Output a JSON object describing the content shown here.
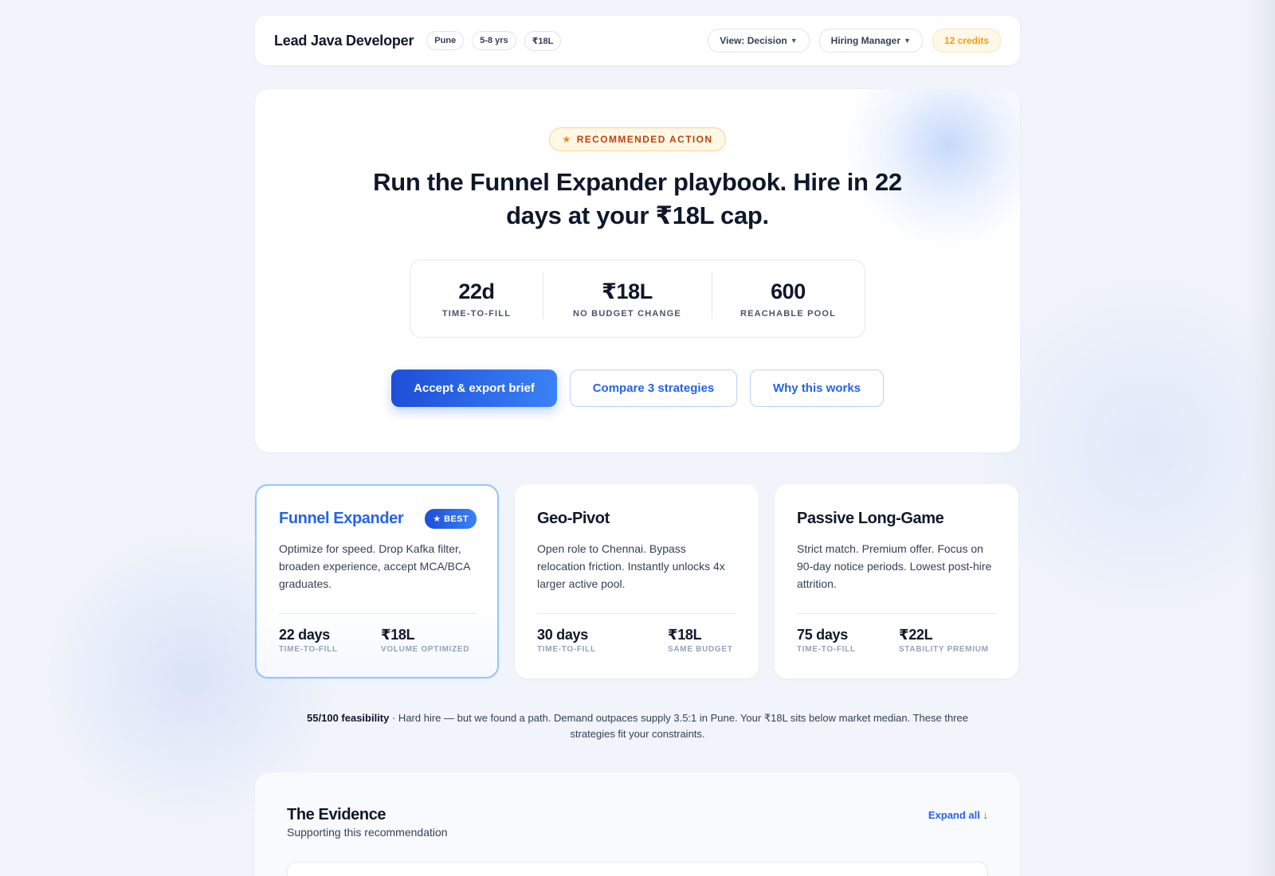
{
  "header": {
    "job_title": "Lead Java Developer",
    "chips": [
      "Pune",
      "5-8 yrs",
      "₹18L"
    ],
    "view_dropdown": "View: Decision",
    "role_dropdown": "Hiring Manager",
    "credits": "12 credits"
  },
  "hero": {
    "badge": "RECOMMENDED ACTION",
    "headline": "Run the Funnel Expander playbook. Hire in 22 days at your ₹18L cap.",
    "stats": [
      {
        "value": "22d",
        "label": "TIME-TO-FILL"
      },
      {
        "value": "₹18L",
        "label": "NO BUDGET CHANGE"
      },
      {
        "value": "600",
        "label": "REACHABLE POOL"
      }
    ],
    "buttons": {
      "accept": "Accept & export brief",
      "compare": "Compare 3 strategies",
      "why": "Why this works"
    }
  },
  "strategies": [
    {
      "title": "Funnel Expander",
      "badge": "BEST",
      "description": "Optimize for speed. Drop Kafka filter, broaden experience, accept MCA/BCA graduates.",
      "metrics": [
        {
          "value": "22 days",
          "label": "TIME-TO-FILL"
        },
        {
          "value": "₹18L",
          "label": "VOLUME OPTIMIZED"
        }
      ]
    },
    {
      "title": "Geo-Pivot",
      "description": "Open role to Chennai. Bypass relocation friction. Instantly unlocks 4x larger active pool.",
      "metrics": [
        {
          "value": "30 days",
          "label": "TIME-TO-FILL"
        },
        {
          "value": "₹18L",
          "label": "SAME BUDGET"
        }
      ]
    },
    {
      "title": "Passive Long-Game",
      "description": "Strict match. Premium offer. Focus on 90-day notice periods. Lowest post-hire attrition.",
      "metrics": [
        {
          "value": "75 days",
          "label": "TIME-TO-FILL"
        },
        {
          "value": "₹22L",
          "label": "STABILITY PREMIUM"
        }
      ]
    }
  ],
  "feasibility": {
    "score": "55/100 feasibility",
    "text": " · Hard hire — but we found a path. Demand outpaces supply 3.5:1 in Pune. Your ₹18L sits below market median. These three strategies fit your constraints."
  },
  "evidence": {
    "title": "The Evidence",
    "subtitle": "Supporting this recommendation",
    "expand": "Expand all ↓"
  },
  "colors": {
    "accent": "#2563eb",
    "badge_orange": "#c2410c",
    "credits": "#f59e0b",
    "background": "#f1f4fb"
  }
}
